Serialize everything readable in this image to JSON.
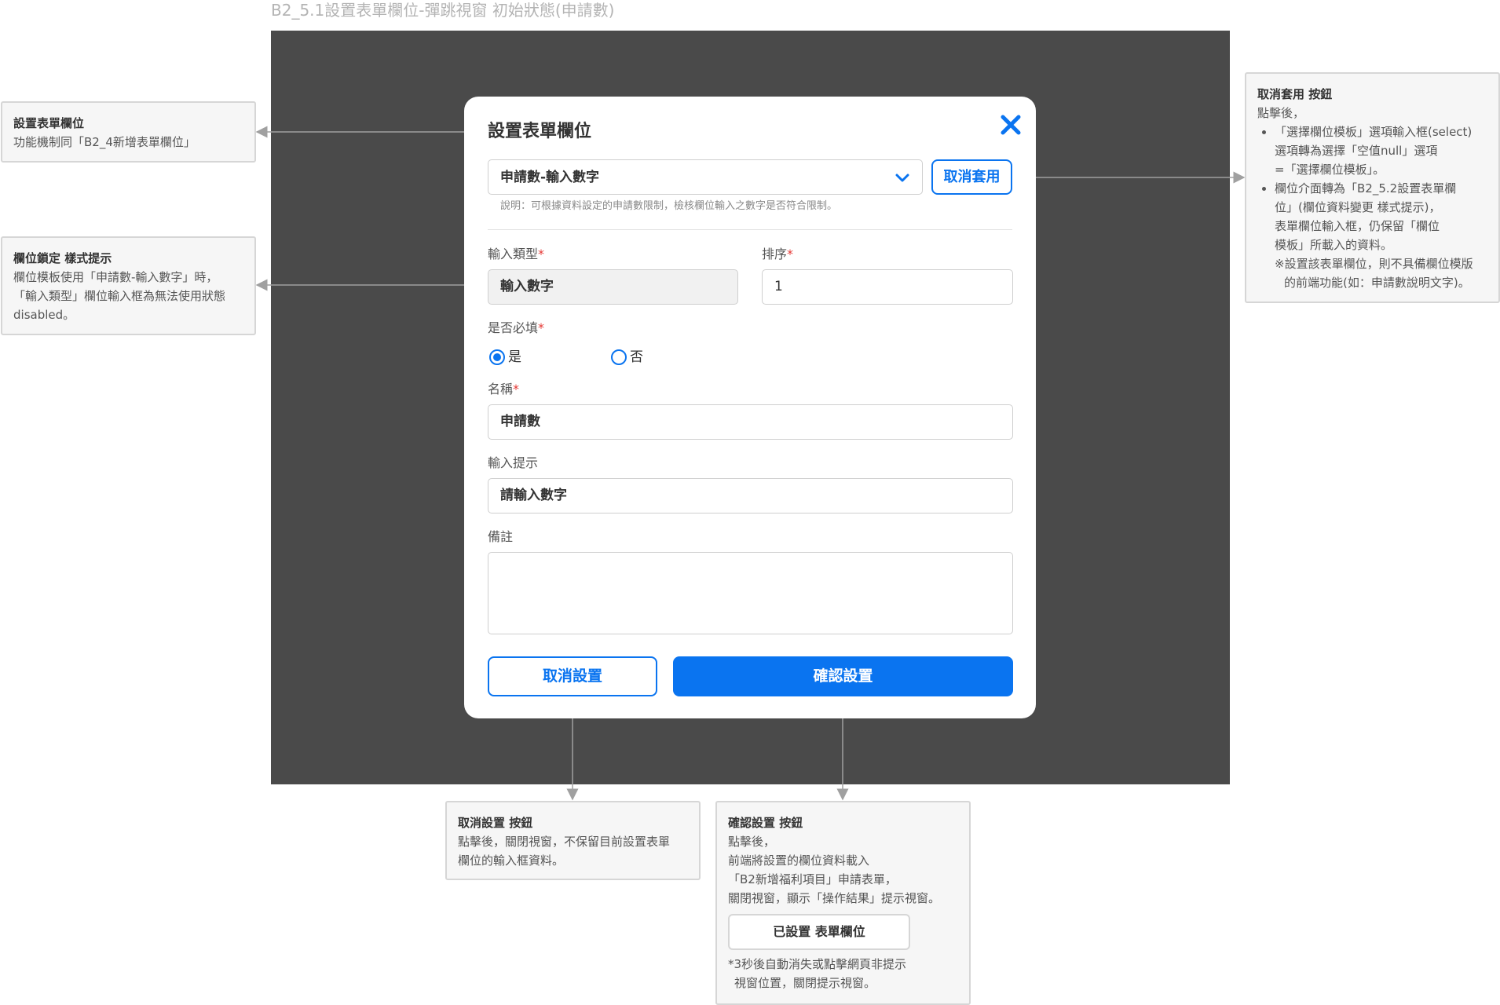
{
  "page_title": "B2_5.1設置表單欄位-彈跳視窗 初始狀態(申請數)",
  "modal": {
    "title": "設置表單欄位",
    "close_icon": "close-icon",
    "template_select": {
      "value": "申請數-輸入數字"
    },
    "cancel_apply_label": "取消套用",
    "hint": "說明：可根據資料設定的申請數限制，檢核欄位輸入之數字是否符合限制。",
    "input_type": {
      "label": "輸入類型",
      "required_mark": "*",
      "value": "輸入數字"
    },
    "order": {
      "label": "排序",
      "required_mark": "*",
      "value": "1"
    },
    "required": {
      "label": "是否必填",
      "required_mark": "*",
      "options": [
        "是",
        "否"
      ],
      "selected": "是"
    },
    "name": {
      "label": "名稱",
      "required_mark": "*",
      "value": "申請數"
    },
    "input_hint": {
      "label": "輸入提示",
      "value": "請輸入數字"
    },
    "remark": {
      "label": "備註",
      "value": ""
    },
    "cancel_button": "取消設置",
    "confirm_button": "確認設置"
  },
  "notes": {
    "form_field": {
      "title": "設置表單欄位",
      "body": "功能機制同「B2_4新增表單欄位」"
    },
    "lock": {
      "title": "欄位鎖定 樣式提示",
      "lines": [
        "欄位模板使用「申請數-輸入數字」時，",
        "「輸入類型」欄位輸入框為無法使用狀態",
        "disabled。"
      ]
    },
    "cancel_apply": {
      "title": "取消套用 按鈕",
      "intro": "點擊後，",
      "bullet1": [
        "「選擇欄位模板」選項輸入框(select)",
        "選項轉為選擇「空值null」選項",
        "=「選擇欄位模板」。"
      ],
      "bullet2": [
        "欄位介面轉為「B2_5.2設置表單欄",
        "位」(欄位資料變更 樣式提示)，",
        "表單欄位輸入框，仍保留「欄位",
        "模板」所載入的資料。"
      ],
      "footnote": [
        "※設置該表單欄位，則不具備欄位模版",
        "的前端功能(如：申請數說明文字)。"
      ]
    },
    "cancel_setting": {
      "title": "取消設置 按鈕",
      "lines": [
        "點擊後，關閉視窗，不保留目前設置表單",
        "欄位的輸入框資料。"
      ]
    },
    "confirm_setting": {
      "title": "確認設置 按鈕",
      "lines": [
        "點擊後，",
        "前端將設置的欄位資料載入",
        "「B2新增福利項目」申請表單，",
        "關閉視窗，顯示「操作結果」提示視窗。"
      ],
      "toast": "已設置 表單欄位",
      "footnote": [
        "*3秒後自動消失或點擊網頁非提示",
        "視窗位置，關閉提示視窗。"
      ]
    }
  },
  "colors": {
    "accent": "#0a74f0",
    "overlay": "#4a4a4a",
    "required": "#e53935"
  }
}
